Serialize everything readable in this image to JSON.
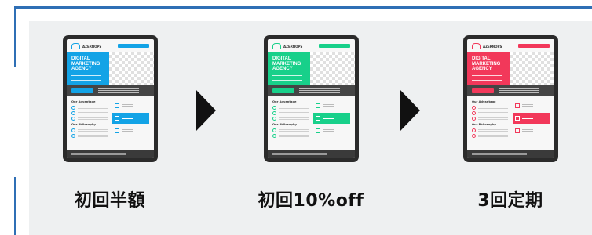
{
  "colors": {
    "frame": "#2f6fb5",
    "panel": "#eef0f1",
    "card_blue": "#13a3e6",
    "card_green": "#18d08a",
    "card_red": "#f2385a"
  },
  "cards": [
    {
      "brand": "AZERNOPS",
      "hero_text": "DIGITAL MARKETING AGENCY",
      "section_advantage": "Our Advantage",
      "section_philosophy": "Our Philosophy",
      "label": "初回半額"
    },
    {
      "brand": "AZERNOPS",
      "hero_text": "DIGITAL MARKETING AGENCY",
      "section_advantage": "Our Advantage",
      "section_philosophy": "Our Philosophy",
      "label": "初回10%off"
    },
    {
      "brand": "AZERNOPS",
      "hero_text": "DIGITAL MARKETING AGENCY",
      "section_advantage": "Our Advantage",
      "section_philosophy": "Our Philosophy",
      "label": "3回定期"
    }
  ],
  "arrows": [
    "arrow-right-icon",
    "arrow-right-icon"
  ]
}
